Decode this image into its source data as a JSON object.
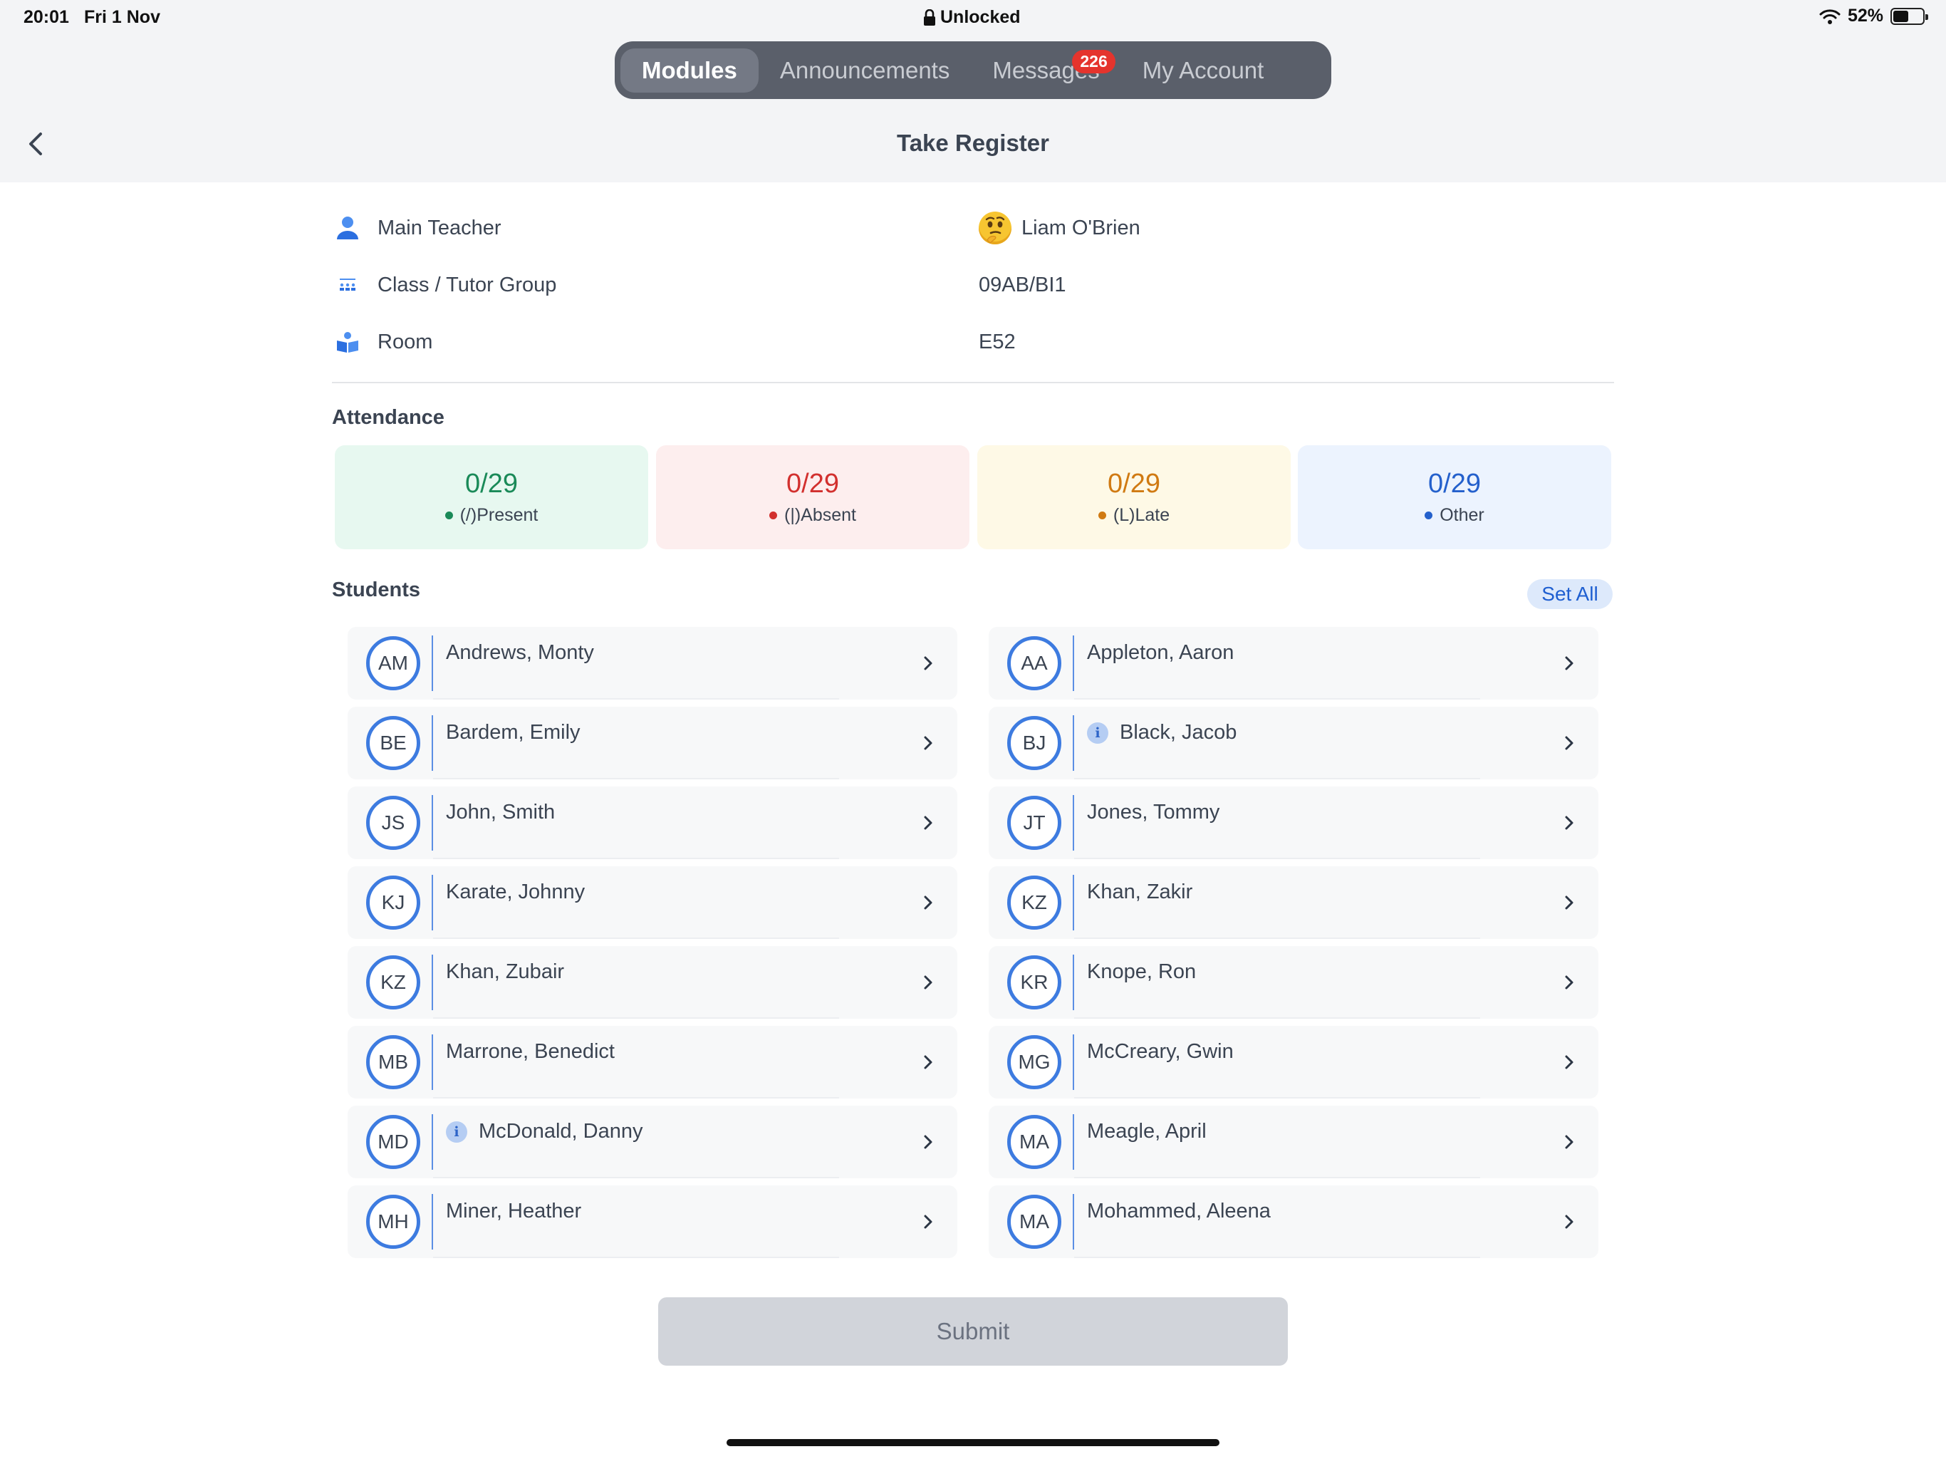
{
  "status_bar": {
    "time": "20:01",
    "date": "Fri 1 Nov",
    "lock_text": "Unlocked",
    "battery": "52%",
    "battery_level": 0.52
  },
  "nav": {
    "tabs": [
      {
        "label": "Modules",
        "active": true
      },
      {
        "label": "Announcements",
        "active": false
      },
      {
        "label": "Messages",
        "active": false,
        "badge": "226"
      },
      {
        "label": "My Account",
        "active": false
      }
    ]
  },
  "header": {
    "title": "Take Register"
  },
  "info": {
    "main_teacher_label": "Main Teacher",
    "main_teacher_value": "Liam O'Brien",
    "class_label": "Class / Tutor Group",
    "class_value": "09AB/BI1",
    "room_label": "Room",
    "room_value": "E52"
  },
  "attendance": {
    "title": "Attendance",
    "cards": [
      {
        "count": "0/29",
        "label": "(/)Present",
        "color": "#1a8a58",
        "bg": "#e7f8f0",
        "dot": "#1a8a58"
      },
      {
        "count": "0/29",
        "label": "(|)Absent",
        "color": "#d2302e",
        "bg": "#fdeeee",
        "dot": "#d2302e"
      },
      {
        "count": "0/29",
        "label": "(L)Late",
        "color": "#d07a12",
        "bg": "#fef9e6",
        "dot": "#d07a12"
      },
      {
        "count": "0/29",
        "label": "Other",
        "color": "#2460cc",
        "bg": "#ecf3fe",
        "dot": "#2460cc"
      }
    ]
  },
  "students": {
    "title": "Students",
    "set_all_label": "Set All",
    "list": [
      {
        "initials": "AM",
        "name": "Andrews, Monty",
        "info": false
      },
      {
        "initials": "AA",
        "name": "Appleton, Aaron",
        "info": false
      },
      {
        "initials": "BE",
        "name": "Bardem, Emily",
        "info": false
      },
      {
        "initials": "BJ",
        "name": "Black, Jacob",
        "info": true
      },
      {
        "initials": "JS",
        "name": "John, Smith",
        "info": false
      },
      {
        "initials": "JT",
        "name": "Jones, Tommy",
        "info": false
      },
      {
        "initials": "KJ",
        "name": "Karate, Johnny",
        "info": false
      },
      {
        "initials": "KZ",
        "name": "Khan, Zakir",
        "info": false
      },
      {
        "initials": "KZ",
        "name": "Khan, Zubair",
        "info": false
      },
      {
        "initials": "KR",
        "name": "Knope, Ron",
        "info": false
      },
      {
        "initials": "MB",
        "name": "Marrone, Benedict",
        "info": false
      },
      {
        "initials": "MG",
        "name": "McCreary, Gwin",
        "info": false
      },
      {
        "initials": "MD",
        "name": "McDonald, Danny",
        "info": true
      },
      {
        "initials": "MA",
        "name": "Meagle, April",
        "info": false
      },
      {
        "initials": "MH",
        "name": "Miner, Heather",
        "info": false
      },
      {
        "initials": "MA",
        "name": "Mohammed, Aleena",
        "info": false
      }
    ]
  },
  "footer": {
    "submit_label": "Submit"
  },
  "colors": {
    "accent": "#3d7be0",
    "nav_bg": "#5a5f6a",
    "badge": "#e5342d"
  }
}
